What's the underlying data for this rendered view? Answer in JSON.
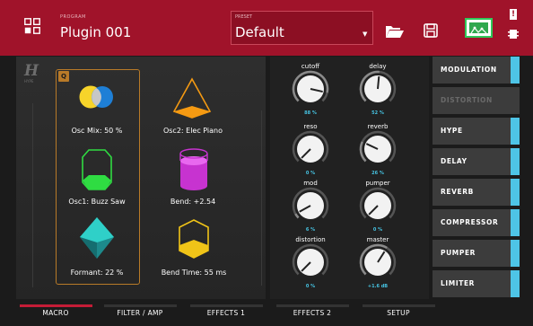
{
  "header": {
    "plugin_caption": "PROGRAM",
    "plugin_name": "Plugin 001",
    "preset_caption": "PRESET",
    "preset_value": "Default",
    "icons": [
      "grid-icon",
      "folder-icon",
      "save-icon",
      "waveform-icon",
      "alert-icon",
      "chip-icon"
    ],
    "colors": {
      "header_bg": "#a0132a",
      "wave_green": "#30c85a"
    }
  },
  "panel": {
    "logo": "H",
    "logo_sub": "HYPE",
    "macro_badge": "Q",
    "macros": [
      {
        "label": "Osc Mix: 50 %",
        "icon": "venn-circles-icon"
      },
      {
        "label": "Osc2: Elec Piano",
        "icon": "pyramid-icon"
      },
      {
        "label": "Osc1: Buzz Saw",
        "icon": "octagon-prism-icon"
      },
      {
        "label": "Bend: +2.54",
        "icon": "cylinder-icon"
      },
      {
        "label": "Formant: 22 %",
        "icon": "diamond-icon"
      },
      {
        "label": "Bend Time: 55 ms",
        "icon": "hexagon-prism-icon"
      }
    ]
  },
  "knobs": [
    {
      "label": "cutoff",
      "value": "88 %",
      "level": 0.88
    },
    {
      "label": "delay",
      "value": "52 %",
      "level": 0.52
    },
    {
      "label": "reso",
      "value": "0 %",
      "level": 0.0
    },
    {
      "label": "reverb",
      "value": "26 %",
      "level": 0.26
    },
    {
      "label": "mod",
      "value": "6 %",
      "level": 0.06
    },
    {
      "label": "pumper",
      "value": "0 %",
      "level": 0.0
    },
    {
      "label": "distortion",
      "value": "0 %",
      "level": 0.0
    },
    {
      "label": "master",
      "value": "+1.6 dB",
      "level": 0.62
    }
  ],
  "sidebar": {
    "items": [
      {
        "label": "MODULATION",
        "enabled": true
      },
      {
        "label": "DISTORTION",
        "enabled": false
      },
      {
        "label": "HYPE",
        "enabled": true
      },
      {
        "label": "DELAY",
        "enabled": true
      },
      {
        "label": "REVERB",
        "enabled": true
      },
      {
        "label": "COMPRESSOR",
        "enabled": true
      },
      {
        "label": "PUMPER",
        "enabled": true
      },
      {
        "label": "LIMITER",
        "enabled": true
      }
    ],
    "accent": "#4ec4e6"
  },
  "tabs": [
    {
      "label": "MACRO",
      "active": true
    },
    {
      "label": "FILTER / AMP",
      "active": false
    },
    {
      "label": "EFFECTS 1",
      "active": false
    },
    {
      "label": "EFFECTS 2",
      "active": false
    },
    {
      "label": "SETUP",
      "active": false
    }
  ]
}
